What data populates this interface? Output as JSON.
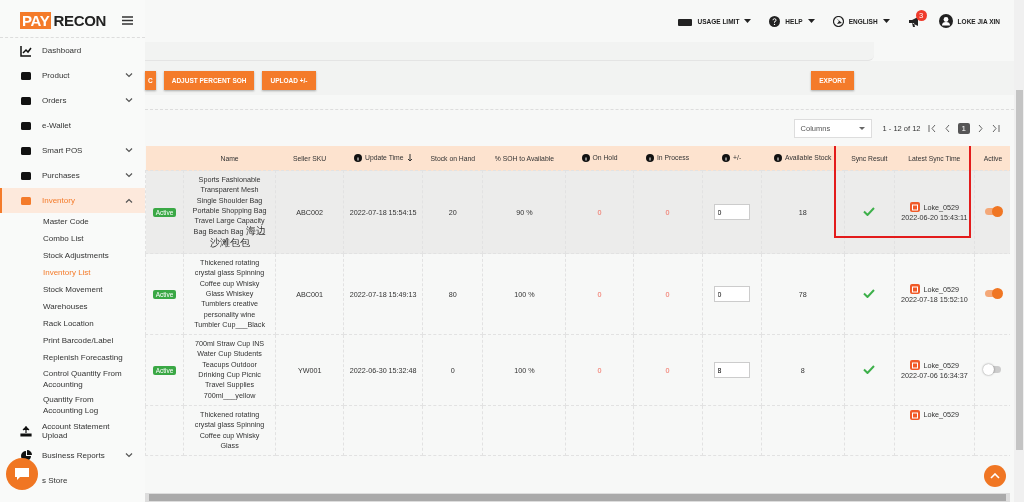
{
  "logo": {
    "part1": "PAY",
    "part2": "RECON"
  },
  "sidebar": {
    "items": [
      {
        "label": "Dashboard",
        "selected": false
      },
      {
        "label": "Product",
        "expanded": false,
        "selected": false
      },
      {
        "label": "Orders",
        "expanded": false,
        "selected": false
      },
      {
        "label": "e-Wallet",
        "selected": false
      },
      {
        "label": "Smart POS",
        "expanded": false,
        "selected": false
      },
      {
        "label": "Purchases",
        "expanded": false,
        "selected": false
      },
      {
        "label": "Inventory",
        "expanded": true,
        "selected": true,
        "children": [
          {
            "label": "Master Code",
            "selected": false
          },
          {
            "label": "Combo List",
            "selected": false
          },
          {
            "label": "Stock Adjustments",
            "selected": false
          },
          {
            "label": "Inventory List",
            "selected": true
          },
          {
            "label": "Stock Movement",
            "selected": false
          },
          {
            "label": "Warehouses",
            "selected": false
          },
          {
            "label": "Rack Location",
            "selected": false
          },
          {
            "label": "Print Barcode/Label",
            "selected": false
          },
          {
            "label": "Replenish Forecasting",
            "selected": false
          },
          {
            "label": "Control Quantity From Accounting",
            "selected": false
          },
          {
            "label": "Quantity From Accounting Log",
            "selected": false
          }
        ]
      },
      {
        "label": "Account Statement Upload",
        "selected": false
      },
      {
        "label": "Business Reports",
        "expanded": false,
        "selected": false
      },
      {
        "label": "s Store",
        "selected": false
      }
    ]
  },
  "header": {
    "usage_limit": "USAGE LIMIT",
    "help": "HELP",
    "language": "ENGLISH",
    "notification_count": "3",
    "user": "LOKE JIA XIN"
  },
  "actions": {
    "left": [
      "C",
      "ADJUST PERCENT SOH",
      "UPLOAD +/-"
    ],
    "export": "EXPORT"
  },
  "toolbar": {
    "columns_placeholder": "Columns",
    "range": "1 - 12 of 12",
    "page": "1"
  },
  "table": {
    "columns": [
      {
        "info": false,
        "sort": false
      },
      {
        "label": "Name",
        "info": false,
        "sort": false
      },
      {
        "label": "Seller SKU",
        "info": false,
        "sort": false
      },
      {
        "label": "Update Time",
        "info": true,
        "sort": true
      },
      {
        "label": "Stock on Hand",
        "info": false,
        "sort": false
      },
      {
        "label": "% SOH to Available",
        "info": false,
        "sort": false
      },
      {
        "label": "On Hold",
        "info": true,
        "sort": false
      },
      {
        "label": "In Process",
        "info": true,
        "sort": false
      },
      {
        "label": "+/-",
        "info": true,
        "sort": false
      },
      {
        "label": "Available Stock",
        "info": true,
        "sort": false
      },
      {
        "label": "Sync Result",
        "info": false,
        "sort": false
      },
      {
        "label": "Latest Sync Time",
        "info": false,
        "sort": false
      },
      {
        "label": "Active",
        "info": false,
        "sort": false
      }
    ],
    "rows": [
      {
        "selected": true,
        "status": "Active",
        "name": "Sports Fashionable Transparent Mesh Single Shoulder Bag Portable Shopping Bag Travel Large Capacity Bag Beach Bag 海边沙滩包包",
        "sku": "ABC002",
        "update_time": "2022-07-18 15:54:15",
        "stock_on_hand": "20",
        "soh_percent": "90 %",
        "on_hold": "0",
        "in_process": "0",
        "adjust": "0",
        "available": "18",
        "synced": true,
        "shop": "Loke_0529",
        "sync_time": "2022-06-20 15:43:11",
        "active": true
      },
      {
        "selected": false,
        "status": "Active",
        "name": "Thickened rotating crystal glass Spinning Coffee cup Whisky Glass Whiskey Tumblers creative personality wine Tumbler Cup___Black",
        "sku": "ABC001",
        "update_time": "2022-07-18 15:49:13",
        "stock_on_hand": "80",
        "soh_percent": "100 %",
        "on_hold": "0",
        "in_process": "0",
        "adjust": "0",
        "available": "78",
        "synced": true,
        "shop": "Loke_0529",
        "sync_time": "2022-07-18 15:52:10",
        "active": true
      },
      {
        "selected": false,
        "status": "Active",
        "name": "700ml Straw Cup INS Water Cup Students Teacups Outdoor Drinking Cup Picnic Travel Supplies 700ml___yellow",
        "sku": "YW001",
        "update_time": "2022-06-30 15:32:48",
        "stock_on_hand": "0",
        "soh_percent": "100 %",
        "on_hold": "0",
        "in_process": "0",
        "adjust": "8",
        "available": "8",
        "synced": true,
        "shop": "Loke_0529",
        "sync_time": "2022-07-06 16:34:37",
        "active": false
      }
    ],
    "partial_row": {
      "name": "Thickened rotating crystal glass Spinning Coffee cup Whisky Glass",
      "shop": "Loke_0529"
    }
  }
}
